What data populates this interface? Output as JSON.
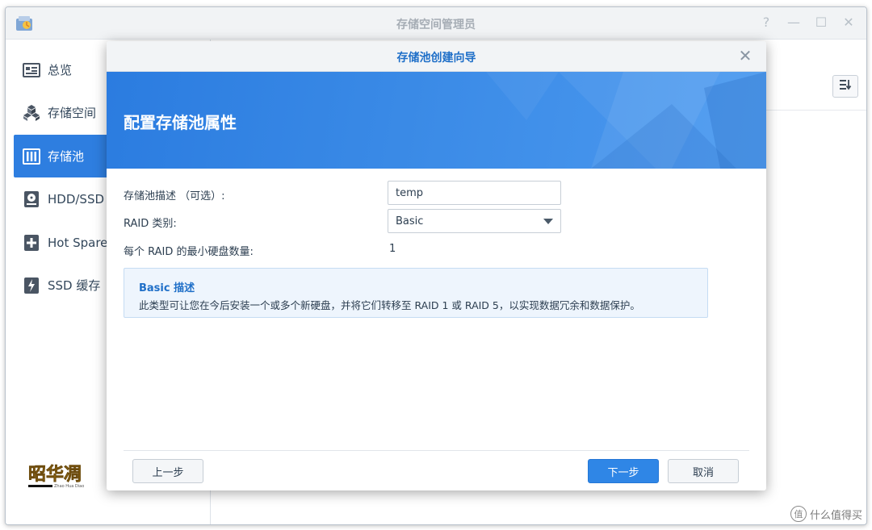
{
  "app": {
    "title": "存储空间管理员"
  },
  "window_controls": {
    "help": "?",
    "minimize": "—",
    "maximize": "☐",
    "close": "✕"
  },
  "sidebar": {
    "items": [
      {
        "label": "总览",
        "icon": "overview-icon"
      },
      {
        "label": "存储空间",
        "icon": "cubes-icon"
      },
      {
        "label": "存储池",
        "icon": "storage-pool-icon",
        "active": true
      },
      {
        "label": "HDD/SSD",
        "icon": "disk-icon"
      },
      {
        "label": "Hot Spare",
        "icon": "hot-spare-icon"
      },
      {
        "label": "SSD 缓存",
        "icon": "ssd-cache-icon"
      }
    ]
  },
  "wizard": {
    "title": "存储池创建向导",
    "banner_title": "配置存储池属性",
    "fields": {
      "description_label": "存储池描述 （可选）:",
      "description_value": "temp",
      "raid_label": "RAID 类别:",
      "raid_value": "Basic",
      "min_disks_label": "每个 RAID 的最小硬盘数量:",
      "min_disks_value": "1"
    },
    "info": {
      "title": "Basic 描述",
      "text": "此类型可让您在今后安装一个或多个新硬盘，并将它们转移至 RAID 1 或 RAID 5，以实现数据冗余和数据保护。"
    },
    "buttons": {
      "prev": "上一步",
      "next": "下一步",
      "cancel": "取消"
    }
  },
  "watermark": {
    "text": "什么值得买",
    "icon_char": "值"
  },
  "colors": {
    "accent": "#2e7ee0",
    "banner": "#3a8ae6",
    "info_bg": "#eef5fd"
  }
}
